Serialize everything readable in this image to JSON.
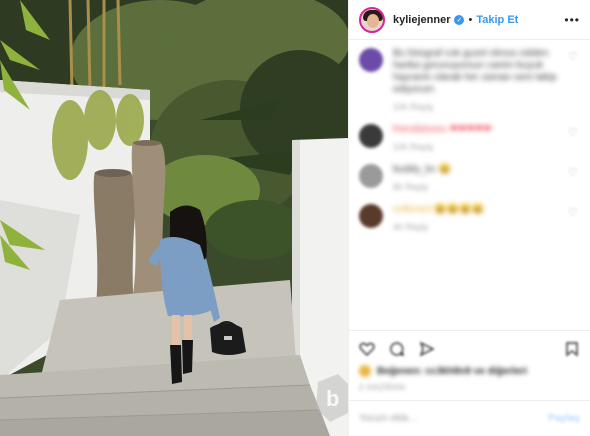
{
  "post": {
    "username": "kyliejenner",
    "verified_mark": "✓",
    "separator": "•",
    "follow_label": "Takip Et",
    "more_label": "•••"
  },
  "comments": [
    {
      "avatar_color": "#6b4aa8",
      "text": "Bu fotograf cok guzel olmus cidden harika gorunuyorsun canim buyuk hayranin olarak her zaman seni takip ediyorum",
      "meta": "10h  Reply"
    },
    {
      "avatar_color": "#3a3a3a",
      "text": "friendsloveu ❤❤❤❤❤",
      "meta": "10h  Reply"
    },
    {
      "avatar_color": "#9a9a9a",
      "text": "buddy_kv 😀",
      "meta": "8h  Reply"
    },
    {
      "avatar_color": "#5a3a2a",
      "text": "softened 😀😀😀😀",
      "meta": "4h  Reply"
    }
  ],
  "likes_text": "Beğenen: cc3kh8n9 ve diğerleri",
  "date_text": "2 HAZİRAN",
  "add_comment": {
    "placeholder": "Yorum ekle...",
    "post_label": "Paylaş"
  },
  "colors": {
    "accent": "#3897f0",
    "heart": "#ed4956",
    "border": "#efefef"
  },
  "icons": [
    "heart-icon",
    "comment-icon",
    "share-icon",
    "bookmark-icon",
    "more-icon",
    "verified-icon"
  ]
}
